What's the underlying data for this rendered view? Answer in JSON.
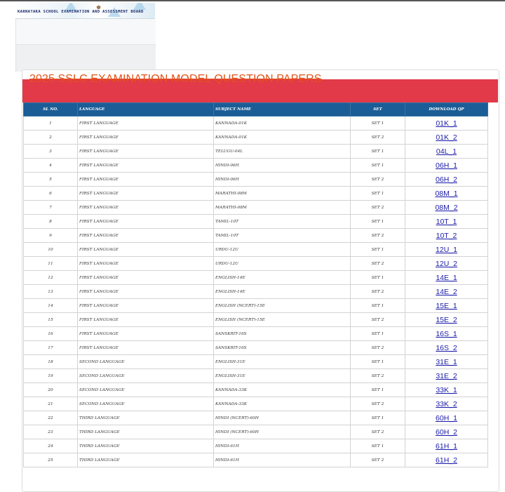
{
  "header": {
    "logo_text": "KARNATAKA SCHOOL EXAMINATION AND ASSESSMENT BOARD",
    "emblem_icon": "state-emblem-icon"
  },
  "main": {
    "title": "2025 SSLC EXAMINATION MODEL QUESTION PAPERS"
  },
  "table": {
    "headers": [
      "Sl No.",
      "LANGUAGE",
      "SUBJECT NAME",
      "SET",
      "DOWNLOAD QP"
    ],
    "rows": [
      {
        "no": "1",
        "language": "FIRST LANGUAGE",
        "subject": "KANNADA-01K",
        "set": "SET 1",
        "link": "01K_1"
      },
      {
        "no": "2",
        "language": "FIRST LANGUAGE",
        "subject": "KANNADA-01K",
        "set": "SET 2",
        "link": "01K_2"
      },
      {
        "no": "3",
        "language": "FIRST LANGUAGE",
        "subject": "TELUGU-04L",
        "set": "SET 1",
        "link": "04L_1"
      },
      {
        "no": "4",
        "language": "FIRST LANGUAGE",
        "subject": "HINDI-06H",
        "set": "SET 1",
        "link": "06H_1"
      },
      {
        "no": "5",
        "language": "FIRST LANGUAGE",
        "subject": "HINDI-06H",
        "set": "SET 2",
        "link": "06H_2"
      },
      {
        "no": "6",
        "language": "FIRST LANGUAGE",
        "subject": "MARATHI-08M",
        "set": "SET 1",
        "link": "08M_1"
      },
      {
        "no": "7",
        "language": "FIRST LANGUAGE",
        "subject": "MARATHI-08M",
        "set": "SET 2",
        "link": "08M_2"
      },
      {
        "no": "8",
        "language": "FIRST LANGUAGE",
        "subject": "TAMIL-10T",
        "set": "SET 1",
        "link": "10T_1"
      },
      {
        "no": "9",
        "language": "FIRST LANGUAGE",
        "subject": "TAMIL-10T",
        "set": "SET 2",
        "link": "10T_2"
      },
      {
        "no": "10",
        "language": "FIRST LANGUAGE",
        "subject": "URDU-12U",
        "set": "SET 1",
        "link": "12U_1"
      },
      {
        "no": "11",
        "language": "FIRST LANGUAGE",
        "subject": "URDU-12U",
        "set": "SET 2",
        "link": "12U_2"
      },
      {
        "no": "12",
        "language": "FIRST LANGUAGE",
        "subject": "ENGLISH-14E",
        "set": "SET 1",
        "link": "14E_1"
      },
      {
        "no": "13",
        "language": "FIRST LANGUAGE",
        "subject": "ENGLISH-14E",
        "set": "SET 2",
        "link": "14E_2"
      },
      {
        "no": "14",
        "language": "FIRST LANGUAGE",
        "subject": "ENGLISH (NCERT)-15E",
        "set": "SET 1",
        "link": "15E_1"
      },
      {
        "no": "15",
        "language": "FIRST LANGUAGE",
        "subject": "ENGLISH (NCERT)-15E",
        "set": "SET 2",
        "link": "15E_2"
      },
      {
        "no": "16",
        "language": "FIRST LANGUAGE",
        "subject": "SANSKRIT-16S",
        "set": "SET 1",
        "link": "16S_1"
      },
      {
        "no": "17",
        "language": "FIRST LANGUAGE",
        "subject": "SANSKRIT-16S",
        "set": "SET 2",
        "link": "16S_2"
      },
      {
        "no": "18",
        "language": "SECOND LANGUAGE",
        "subject": "ENGLISH-31E",
        "set": "SET 1",
        "link": "31E_1"
      },
      {
        "no": "19",
        "language": "SECOND LANGUAGE",
        "subject": "ENGLISH-31E",
        "set": "SET 2",
        "link": "31E_2"
      },
      {
        "no": "20",
        "language": "SECOND LANGUAGE",
        "subject": "KANNADA-33K",
        "set": "SET 1",
        "link": "33K_1"
      },
      {
        "no": "21",
        "language": "SECOND LANGUAGE",
        "subject": "KANNADA-33K",
        "set": "SET 2",
        "link": "33K_2"
      },
      {
        "no": "22",
        "language": "THIRD LANGUAGE",
        "subject": "HINDI (NCERT)-60H",
        "set": "SET 1",
        "link": "60H_1"
      },
      {
        "no": "23",
        "language": "THIRD LANGUAGE",
        "subject": "HINDI (NCERT)-60H",
        "set": "SET 2",
        "link": "60H_2"
      },
      {
        "no": "24",
        "language": "THIRD LANGUAGE",
        "subject": "HINDI-61H",
        "set": "SET 1",
        "link": "61H_1"
      },
      {
        "no": "25",
        "language": "THIRD LANGUAGE",
        "subject": "HINDI-61H",
        "set": "SET 2",
        "link": "61H_2"
      }
    ]
  },
  "colors": {
    "title_band": "#e23a48",
    "title_text": "#e2541c",
    "table_header": "#1b5d96",
    "link": "#1a1aa8"
  }
}
